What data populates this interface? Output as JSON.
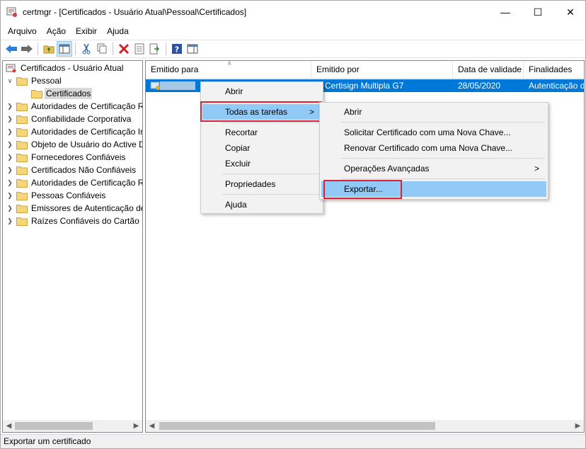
{
  "window": {
    "title": "certmgr - [Certificados - Usuário Atual\\Pessoal\\Certificados]",
    "minimize_glyph": "—",
    "maximize_glyph": "☐",
    "close_glyph": "✕"
  },
  "menubar": {
    "items": [
      "Arquivo",
      "Ação",
      "Exibir",
      "Ajuda"
    ]
  },
  "toolbar": {
    "icons": [
      "back-arrow-icon",
      "forward-arrow-icon",
      "up-folder-icon",
      "show-hide-tree-icon",
      "cut-icon",
      "copy-icon",
      "delete-icon",
      "properties-icon",
      "export-list-icon",
      "help-icon",
      "show-action-pane-icon"
    ]
  },
  "tree": {
    "root": "Certificados - Usuário Atual",
    "pessoal": "Pessoal",
    "certificados": "Certificados",
    "items": [
      "Autoridades de Certificação Raiz Confiáveis",
      "Confiabilidade Corporativa",
      "Autoridades de Certificação Intermediárias",
      "Objeto de Usuário do Active Directory",
      "Fornecedores Confiáveis",
      "Certificados Não Confiáveis",
      "Autoridades de Certificação Raiz de Terceiros",
      "Pessoas Confiáveis",
      "Emissores de Autenticação de Cliente",
      "Raízes Confiáveis do Cartão Inteligente"
    ]
  },
  "list": {
    "columns": [
      "Emitido para",
      "Emitido por",
      "Data de validade",
      "Finalidades"
    ],
    "row": {
      "issued_to": "",
      "issued_by": "C Certisign Multipla G7",
      "expiry": "28/05/2020",
      "purposes": "Autenticação de cliente"
    }
  },
  "context_menu": {
    "abrir": "Abrir",
    "todas_tarefas": "Todas as tarefas",
    "recortar": "Recortar",
    "copiar": "Copiar",
    "excluir": "Excluir",
    "propriedades": "Propriedades",
    "ajuda": "Ajuda",
    "submenu_arrow": ">"
  },
  "submenu": {
    "abrir": "Abrir",
    "solicitar": "Solicitar Certificado com uma Nova Chave...",
    "renovar": "Renovar Certificado com uma Nova Chave...",
    "operacoes": "Operações Avançadas",
    "exportar": "Exportar...",
    "submenu_arrow": ">"
  },
  "statusbar": {
    "text": "Exportar um certificado"
  },
  "colors": {
    "selection": "#0078d7",
    "menu_highlight": "#91c9f7",
    "annotation_red": "#e02030"
  }
}
